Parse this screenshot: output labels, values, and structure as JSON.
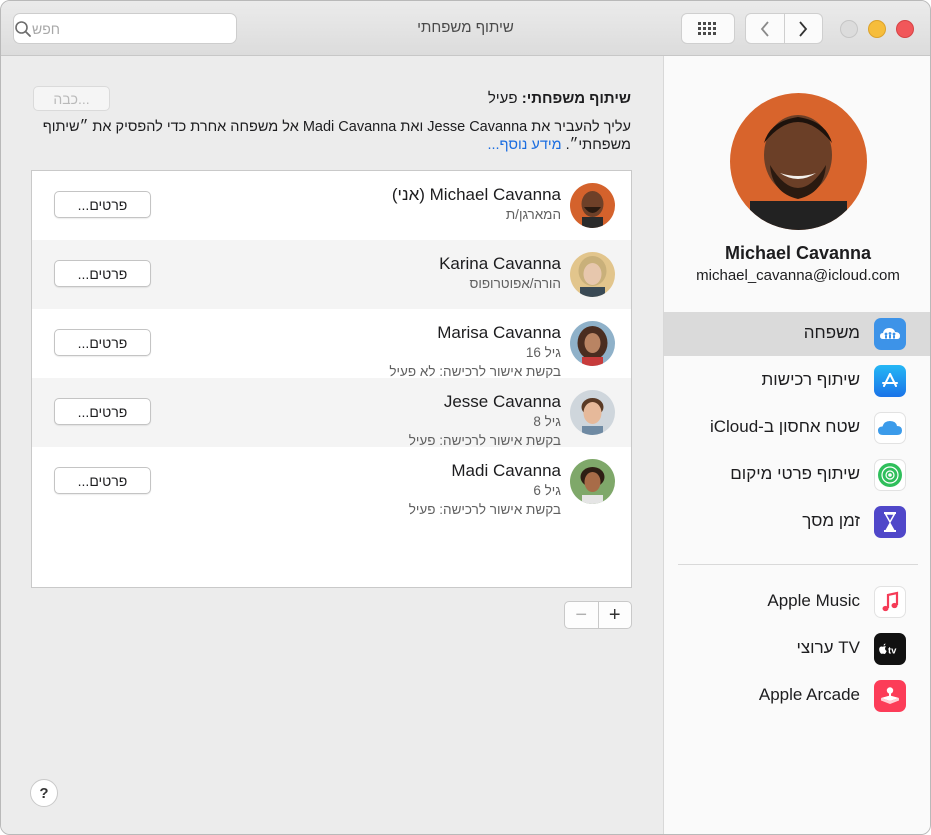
{
  "window": {
    "title": "שיתוף משפחתי",
    "search_placeholder": "חפש"
  },
  "main": {
    "done_label": "כבה...",
    "status_label": "שיתוף משפחתי:",
    "status_value": "פעיל",
    "description_text": "עליך להעביר את Jesse Cavanna ואת Madi Cavanna אל משפחה אחרת כדי להפסיק את ״שיתוף משפחתי״.",
    "description_link": "מידע נוסף...",
    "members": [
      {
        "name": "Michael Cavanna (אני)",
        "line1": "המארגן/ת",
        "line2": "",
        "details": "פרטים..."
      },
      {
        "name": "Karina Cavanna",
        "line1": "הורה/אפוטרופוס",
        "line2": "",
        "details": "פרטים..."
      },
      {
        "name": "Marisa Cavanna",
        "line1": "גיל 16",
        "line2": "בקשת אישור לרכישה: לא פעיל",
        "details": "פרטים..."
      },
      {
        "name": "Jesse Cavanna",
        "line1": "גיל 8",
        "line2": "בקשת אישור לרכישה: פעיל",
        "details": "פרטים..."
      },
      {
        "name": "Madi Cavanna",
        "line1": "גיל 6",
        "line2": "בקשת אישור לרכישה: פעיל",
        "details": "פרטים..."
      }
    ],
    "add_label": "+",
    "remove_label": "−",
    "help_label": "?"
  },
  "sidebar": {
    "profile_name": "Michael Cavanna",
    "profile_email": "michael_cavanna@icloud.com",
    "items": [
      {
        "label": "משפחה",
        "icon": "family-icon",
        "selected": true
      },
      {
        "label": "שיתוף רכישות",
        "icon": "app-store-icon",
        "selected": false
      },
      {
        "label": "שטח אחסון ב-iCloud",
        "icon": "icloud-icon",
        "selected": false
      },
      {
        "label": "שיתוף פרטי מיקום",
        "icon": "find-my-icon",
        "selected": false
      },
      {
        "label": "זמן מסך",
        "icon": "screen-time-icon",
        "selected": false
      },
      {
        "label": "Apple Music",
        "icon": "music-icon",
        "selected": false
      },
      {
        "label": "TV ערוצי",
        "icon": "apple-tv-icon",
        "selected": false
      },
      {
        "label": "Apple Arcade",
        "icon": "arcade-icon",
        "selected": false
      }
    ]
  },
  "colors": {
    "link": "#1a6de0",
    "selected_row": "#dadada",
    "traffic_red": "#f1575a",
    "traffic_yellow": "#f6bd3b"
  }
}
